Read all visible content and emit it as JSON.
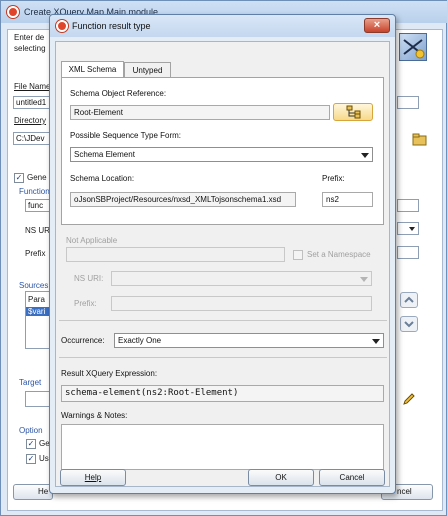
{
  "background_window": {
    "title": "Create XQuery Map Main module",
    "intro_text_1": "Enter de",
    "intro_text_2": "selecting",
    "file_name_label": "File Name",
    "file_name_value": "untitled1",
    "directory_label": "Directory",
    "directory_value": "C:\\JDev",
    "gene_check_label": "Gene",
    "function_label": "Function",
    "function_value": "func",
    "ns_uri_label": "NS URI",
    "prefix_label": "Prefix",
    "sources_label": "Sources",
    "source_items": [
      "Para",
      "$vari"
    ],
    "target_label": "Target",
    "options_label": "Option",
    "option_item_1": "Ge",
    "option_item_2": "Us",
    "help_button_fragment": "He",
    "cancel_button_fragment": "ncel"
  },
  "dialog": {
    "title": "Function result type",
    "close_glyph": "×",
    "tabs": [
      "XML Schema",
      "Untyped"
    ],
    "schema_object_reference_label": "Schema Object Reference:",
    "schema_object_reference_value": "Root-Element",
    "possible_sequence_type_form_label": "Possible Sequence Type Form:",
    "possible_sequence_type_form_value": "Schema Element",
    "schema_location_label": "Schema Location:",
    "schema_location_value": "oJsonSBProject/Resources/nxsd_XMLTojsonschema1.xsd",
    "prefix_label": "Prefix:",
    "prefix_value": "ns2",
    "not_applicable_label": "Not Applicable",
    "set_namespace_label": "Set a Namespace",
    "ns_uri_label": "NS URI:",
    "na_prefix_label": "Prefix:",
    "occurrence_label": "Occurrence:",
    "occurrence_value": "Exactly One",
    "result_xquery_expression_label": "Result XQuery Expression:",
    "result_xquery_expression_value": "schema-element(ns2:Root-Element)",
    "warnings_notes_label": "Warnings & Notes:",
    "warnings_notes_value": "",
    "help_button": "Help",
    "ok_button": "OK",
    "cancel_button": "Cancel"
  }
}
